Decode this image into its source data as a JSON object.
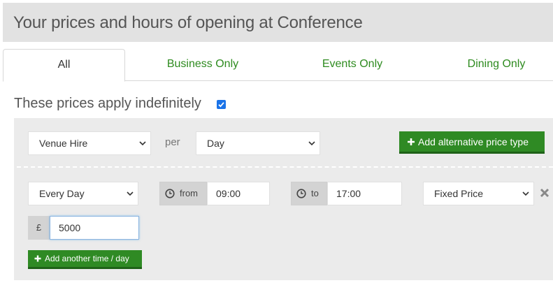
{
  "page": {
    "title": "Your prices and hours of opening at Conference"
  },
  "tabs": [
    {
      "label": "All",
      "active": true
    },
    {
      "label": "Business Only",
      "active": false
    },
    {
      "label": "Events Only",
      "active": false
    },
    {
      "label": "Dining Only",
      "active": false
    }
  ],
  "indefinite": {
    "label": "These prices apply indefinitely",
    "checked": true
  },
  "price_type": {
    "selected": "Venue Hire",
    "per_label": "per",
    "unit_selected": "Day",
    "add_alt_label": "Add alternative price type"
  },
  "time_row": {
    "days_selected": "Every Day",
    "from_label": "from",
    "from_value": "09:00",
    "to_label": "to",
    "to_value": "17:00",
    "pricing_selected": "Fixed Price",
    "currency_symbol": "£",
    "amount": "5000",
    "add_time_label": "Add another time / day"
  },
  "colors": {
    "accent_green": "#2f8a24",
    "tab_green": "#2e8b1f",
    "checkbox_blue": "#1a73e8",
    "panel_gray": "#ebebeb",
    "header_gray": "#e2e2e2"
  },
  "icons": [
    "plus-icon",
    "clock-icon",
    "close-icon",
    "chevron-down-icon",
    "checkbox-check-icon"
  ]
}
